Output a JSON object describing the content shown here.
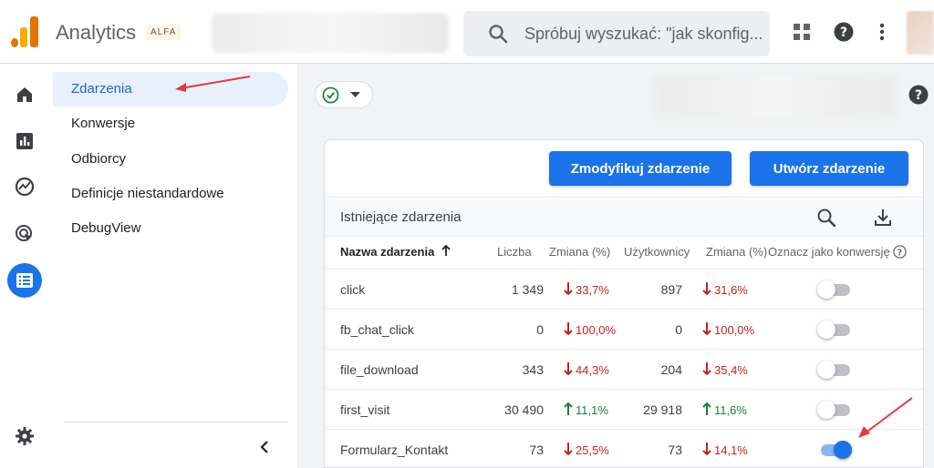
{
  "header": {
    "app_title": "Analytics",
    "badge": "ALFA",
    "search_placeholder": "Spróbuj wyszukać: \"jak skonfig...",
    "colors": {
      "logo_orange": "#f9ab00",
      "logo_dark_orange": "#e37400",
      "accent": "#1a73e8"
    }
  },
  "rail": {
    "icons": [
      "home-icon",
      "reports-icon",
      "explore-icon",
      "advertising-icon",
      "configure-icon",
      "settings-icon"
    ]
  },
  "sidenav": {
    "items": [
      {
        "label": "Zdarzenia",
        "active": true
      },
      {
        "label": "Konwersje",
        "active": false
      },
      {
        "label": "Odbiorcy",
        "active": false
      },
      {
        "label": "Definicje niestandardowe",
        "active": false
      },
      {
        "label": "DebugView",
        "active": false
      }
    ]
  },
  "toolbar": {
    "modify_label": "Zmodyfikuj zdarzenie",
    "create_label": "Utwórz zdarzenie"
  },
  "events": {
    "section_title": "Istniejące zdarzenia",
    "columns": {
      "name": "Nazwa zdarzenia",
      "count": "Liczba",
      "change1": "Zmiana (%)",
      "users": "Użytkownicy",
      "change2": "Zmiana (%)",
      "conversion": "Oznacz jako konwersję"
    },
    "rows": [
      {
        "name": "click",
        "count": "1 349",
        "change1": "33,7%",
        "change1_dir": "down",
        "users": "897",
        "change2": "31,6%",
        "change2_dir": "down",
        "conversion": false
      },
      {
        "name": "fb_chat_click",
        "count": "0",
        "change1": "100,0%",
        "change1_dir": "down",
        "users": "0",
        "change2": "100,0%",
        "change2_dir": "down",
        "conversion": false
      },
      {
        "name": "file_download",
        "count": "343",
        "change1": "44,3%",
        "change1_dir": "down",
        "users": "204",
        "change2": "35,4%",
        "change2_dir": "down",
        "conversion": false
      },
      {
        "name": "first_visit",
        "count": "30 490",
        "change1": "11,1%",
        "change1_dir": "up",
        "users": "29 918",
        "change2": "11,6%",
        "change2_dir": "up",
        "conversion": false
      },
      {
        "name": "Formularz_Kontakt",
        "count": "73",
        "change1": "25,5%",
        "change1_dir": "down",
        "users": "73",
        "change2": "14,1%",
        "change2_dir": "down",
        "conversion": true
      }
    ]
  }
}
